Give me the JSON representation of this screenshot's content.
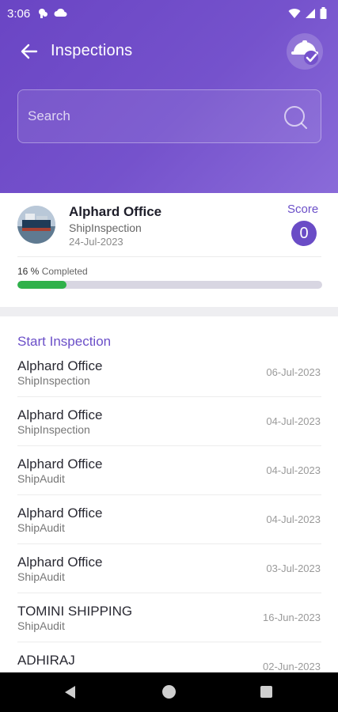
{
  "status_bar": {
    "time": "3:06"
  },
  "toolbar": {
    "title": "Inspections"
  },
  "search": {
    "placeholder": "Search",
    "value": ""
  },
  "current_inspection": {
    "name": "Alphard Office",
    "type": "ShipInspection",
    "date": "24-Jul-2023",
    "score_label": "Score",
    "score": "0",
    "progress_percent": "16 %",
    "progress_label": "Completed",
    "progress_fraction": 0.16
  },
  "list": {
    "header": "Start Inspection",
    "items": [
      {
        "name": "Alphard Office",
        "type": "ShipInspection",
        "date": "06-Jul-2023"
      },
      {
        "name": "Alphard Office",
        "type": "ShipInspection",
        "date": "04-Jul-2023"
      },
      {
        "name": "Alphard Office",
        "type": "ShipAudit",
        "date": "04-Jul-2023"
      },
      {
        "name": "Alphard Office",
        "type": "ShipAudit",
        "date": "04-Jul-2023"
      },
      {
        "name": "Alphard Office",
        "type": "ShipAudit",
        "date": "03-Jul-2023"
      },
      {
        "name": "TOMINI SHIPPING",
        "type": "ShipAudit",
        "date": "16-Jun-2023"
      },
      {
        "name": "ADHIRAJ",
        "type": "",
        "date": "02-Jun-2023"
      }
    ]
  },
  "colors": {
    "header_gradient_start": "#6a45c4",
    "header_gradient_end": "#8a6bd9",
    "accent": "#6b4fc8",
    "progress": "#2fb14a"
  },
  "icons": {
    "back": "arrow-left-icon",
    "helmet": "helmet-check-icon",
    "search": "search-icon"
  }
}
